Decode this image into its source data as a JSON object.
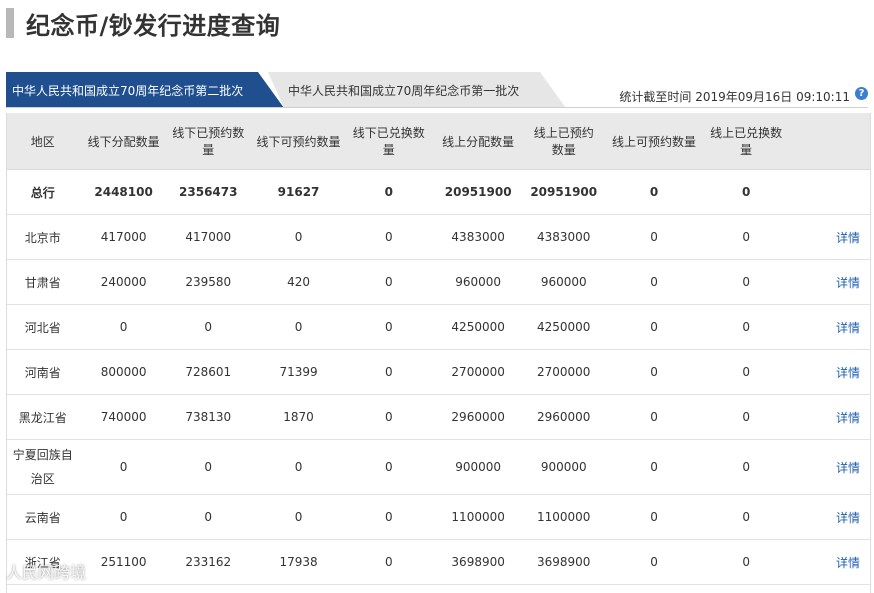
{
  "title": "纪念币/钞发行进度查询",
  "tabs": [
    {
      "label": "中华人民共和国成立70周年纪念币第二批次",
      "active": true
    },
    {
      "label": "中华人民共和国成立70周年纪念币第一批次",
      "active": false
    }
  ],
  "stat_time": "统计截至时间 2019年09月16日 09:10:11",
  "help_icon": "?",
  "columns": [
    "地区",
    "线下分配数量",
    "线下已预约数量",
    "线下可预约数量",
    "线下已兑换数量",
    "线上分配数量",
    "线上已预约数量",
    "线上可预约数量",
    "线上已兑换数量"
  ],
  "total_row": {
    "region": "总行",
    "values": [
      "2448100",
      "2356473",
      "91627",
      "0",
      "20951900",
      "20951900",
      "0",
      "0"
    ]
  },
  "detail_label": "详情",
  "rows": [
    {
      "region": "北京市",
      "values": [
        "417000",
        "417000",
        "0",
        "0",
        "4383000",
        "4383000",
        "0",
        "0"
      ]
    },
    {
      "region": "甘肃省",
      "values": [
        "240000",
        "239580",
        "420",
        "0",
        "960000",
        "960000",
        "0",
        "0"
      ]
    },
    {
      "region": "河北省",
      "values": [
        "0",
        "0",
        "0",
        "0",
        "4250000",
        "4250000",
        "0",
        "0"
      ]
    },
    {
      "region": "河南省",
      "values": [
        "800000",
        "728601",
        "71399",
        "0",
        "2700000",
        "2700000",
        "0",
        "0"
      ]
    },
    {
      "region": "黑龙江省",
      "values": [
        "740000",
        "738130",
        "1870",
        "0",
        "2960000",
        "2960000",
        "0",
        "0"
      ]
    },
    {
      "region": "宁夏回族自治区",
      "values": [
        "0",
        "0",
        "0",
        "0",
        "900000",
        "900000",
        "0",
        "0"
      ]
    },
    {
      "region": "云南省",
      "values": [
        "0",
        "0",
        "0",
        "0",
        "1100000",
        "1100000",
        "0",
        "0"
      ]
    },
    {
      "region": "浙江省",
      "values": [
        "251100",
        "233162",
        "17938",
        "0",
        "3698900",
        "3698900",
        "0",
        "0"
      ]
    }
  ],
  "watermark": "人民网跨境",
  "colors": {
    "tab_active": "#1f4f8f",
    "link": "#1f5fb0",
    "header_bg": "#e9e9e9"
  }
}
